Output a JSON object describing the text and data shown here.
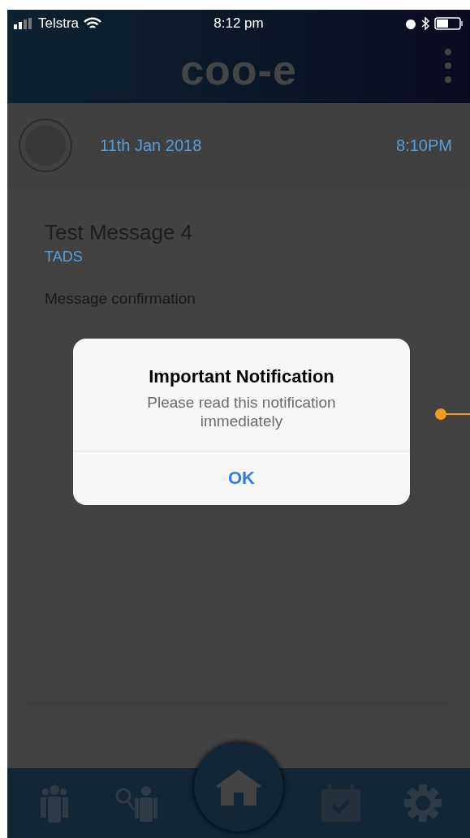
{
  "status_bar": {
    "carrier": "Telstra",
    "time": "8:12 pm"
  },
  "header": {
    "logo": "coo-e"
  },
  "message": {
    "date": "11th Jan 2018",
    "time": "8:10PM",
    "title": "Test Message 4",
    "sender": "TADS",
    "body": "Message confirmation"
  },
  "dialog": {
    "title": "Important Notification",
    "message": "Please read this notification immediately",
    "buttons": [
      "OK"
    ]
  },
  "nav": [
    {
      "kind": "people",
      "selected": false
    },
    {
      "kind": "search-people",
      "selected": false
    },
    {
      "kind": "home",
      "selected": true
    },
    {
      "kind": "calendar",
      "selected": false
    },
    {
      "kind": "settings",
      "selected": false
    }
  ]
}
